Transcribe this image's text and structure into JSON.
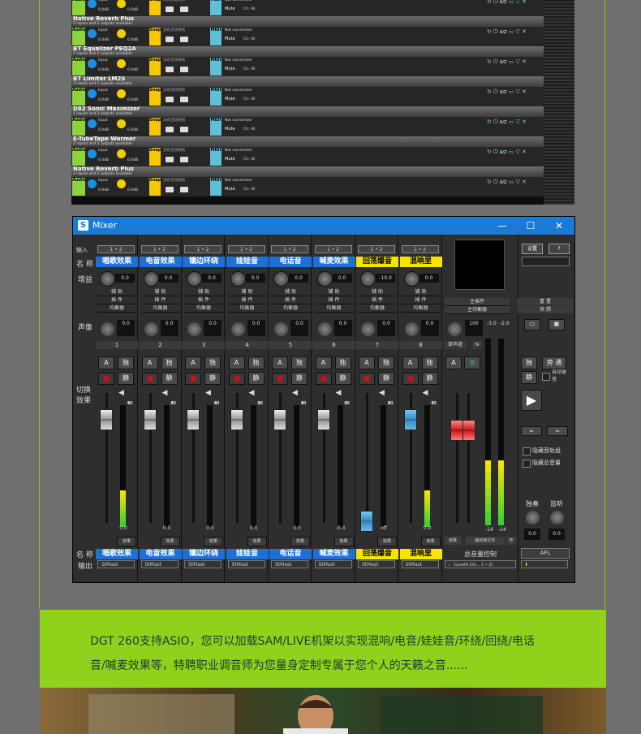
{
  "plugins": [
    {
      "title": "",
      "sub": ""
    },
    {
      "title": "Native Reverb Plus",
      "sub": "2 inputs and 2 outputs available"
    },
    {
      "title": "BT Equalizer PEQ2A",
      "sub": "2 inputs and 2 outputs available"
    },
    {
      "title": "BT Limiter LM2S",
      "sub": "2 inputs and 2 outputs available"
    },
    {
      "title": "D82 Sonic Maximizer",
      "sub": "2 inputs and 2 outputs available"
    },
    {
      "title": "E-TubeTape Warmer",
      "sub": "2 inputs and 2 outputs available"
    },
    {
      "title": "Native Reverb Plus",
      "sub": "2 inputs and 2 outputs available"
    }
  ],
  "plugin_labels": {
    "audio": "Audio",
    "snap": "Snap",
    "midi": "MIDI",
    "input": "Input",
    "db": "0.0dB",
    "snap_text": "没有活动快照",
    "not_connected": "Not connected",
    "mute": "Mute",
    "ch": "Ch: All"
  },
  "mixer": {
    "title": "Mixer",
    "win_min": "—",
    "win_max": "☐",
    "win_close": "✕",
    "row_labels": {
      "input": "输入",
      "name": "名 称",
      "gain": "增益",
      "pan": "声像",
      "switch": "切换效果",
      "bottom_name": "名 称",
      "output": "输出"
    },
    "channels": [
      {
        "in": "1 • 2",
        "name": "唱歌效果",
        "gain": "0.0",
        "pan": "0.0",
        "num": "1",
        "val": "0.0",
        "out": "StMast",
        "yellow": false,
        "level": 0.3
      },
      {
        "in": "1 • 2",
        "name": "电音效果",
        "gain": "0.0",
        "pan": "0.0",
        "num": "2",
        "val": "0.0",
        "out": "StMast",
        "yellow": false,
        "level": 0
      },
      {
        "in": "1 • 2",
        "name": "镶边环绕",
        "gain": "0.0",
        "pan": "0.0",
        "num": "3",
        "val": "0.0",
        "out": "StMast",
        "yellow": false,
        "level": 0
      },
      {
        "in": "1 • 2",
        "name": "娃娃音",
        "gain": "0.0",
        "pan": "0.0",
        "num": "4",
        "val": "0.0",
        "out": "StMast",
        "yellow": false,
        "level": 0
      },
      {
        "in": "1 • 2",
        "name": "电话音",
        "gain": "0.0",
        "pan": "0.0",
        "num": "5",
        "val": "0.0",
        "out": "StMast",
        "yellow": false,
        "level": 0
      },
      {
        "in": "1 • 2",
        "name": "喊麦效果",
        "gain": "0.0",
        "pan": "0.0",
        "num": "6",
        "val": "-0.3",
        "out": "StMast",
        "yellow": false,
        "level": 0
      },
      {
        "in": "1 • 2",
        "name": "回荡爆音",
        "gain": "-10.0",
        "pan": "0.0",
        "num": "7",
        "val": "off",
        "out": "StMast",
        "yellow": true,
        "level": 0
      },
      {
        "in": "1 • 2",
        "name": "混响里",
        "gain": "0.0",
        "pan": "0.0",
        "num": "8",
        "val": "0.0",
        "out": "StMast",
        "yellow": true,
        "level": 0.3
      }
    ],
    "row_texts": [
      "辅 助",
      "插 件",
      "均衡器"
    ],
    "btn_a": "A",
    "btn_solo": "独",
    "btn_mute": "静",
    "fx": "效果",
    "master": {
      "insert": "主插件",
      "eq": "主均衡器",
      "pan": "100",
      "mono": "单声道",
      "n": "N",
      "l": "-3.0",
      "r": "-2.6",
      "ml": "-14",
      "mr": "-24",
      "label": "总音量控制",
      "fx": "效果",
      "rec": "输出到文件",
      "open": "开",
      "out": "1Lewitt DG... 1 • 2)"
    },
    "right": {
      "settings": "设置",
      "help": "?",
      "reset": "重 置",
      "fast": "快 照",
      "solo": "独",
      "solo2": "旁 通",
      "mute": "静",
      "auto": "自动录音",
      "hide_tracks": "隐藏音轨组",
      "hide_master": "隐藏总音量",
      "solo_label": "独奏",
      "monitor_label": "监听",
      "solo_val": "0.0",
      "monitor_val": "0.0",
      "afl": "AFL"
    }
  },
  "banner": {
    "line1": "DGT 260支持ASIO，您可以加载SAM/LIVE机架以实现混响/电音/娃娃音/环绕/回绕/电话",
    "line2": "音/喊麦效果等，特聘职业调音师为您量身定制专属于您个人的天籁之音......"
  },
  "colors": {
    "accent": "#8fd11b",
    "channel_blue": "#1f6fd6",
    "channel_yellow": "#f7e500"
  }
}
